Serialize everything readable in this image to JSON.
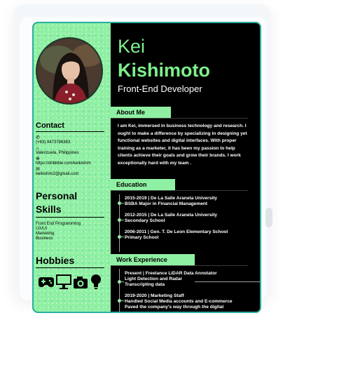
{
  "profile": {
    "first_name": "Kei",
    "last_name": "Kishimoto",
    "title": "Front-End Developer"
  },
  "contact": {
    "heading": "Contact",
    "phone": "(+63) 9473786383",
    "location": "Valenzuela, Philippines",
    "website": "https://dribbble.com/keikishim",
    "email": "keikishim2@gmail.com"
  },
  "skills": {
    "heading_line1": "Personal",
    "heading_line2": "Skills",
    "items": [
      "Front End Programming",
      "UX/UI",
      "Marketing",
      "Business"
    ]
  },
  "hobbies": {
    "heading": "Hobbies",
    "icons": [
      "gamepad-icon",
      "monitor-icon",
      "camera-icon",
      "lightbulb-icon"
    ]
  },
  "about": {
    "heading": "About Me",
    "text": "I am Kei, immersed in business technology and research. I ought to make a difference by specializing in designing yet functional websites and digital interfaces. With proper training as a marketer, it has been my passion to help clients achieve their goals and grow their brands. I work exceptionally hard with my team ."
  },
  "education": {
    "heading": "Education",
    "items": [
      {
        "line1": "2015-2019 | De La Salle Araneta University",
        "line2": "BSBA Major in Financial Management"
      },
      {
        "line1": "2012-2015 | De La Salle Araneta University",
        "line2": "Secondary School"
      },
      {
        "line1": "2006-2011 | Gen. T. De Leon Elementary School",
        "line2": "Primary School"
      }
    ]
  },
  "experience": {
    "heading": "Work Experience",
    "items": [
      {
        "line1": "Present | Freelance LiDAR Data Annotator",
        "line2": "Light Detection and Radar",
        "line3": "Transcripting data"
      },
      {
        "line1": "2019-2020 | Marketing Staff",
        "line2": "Handled Social Media accounts and E-commerce",
        "line3": "Paved the company's way through the digital"
      }
    ]
  },
  "colors": {
    "accent": "#8ff0a3",
    "name": "#7df08c",
    "border": "#2ab0a0",
    "background": "#000000"
  }
}
